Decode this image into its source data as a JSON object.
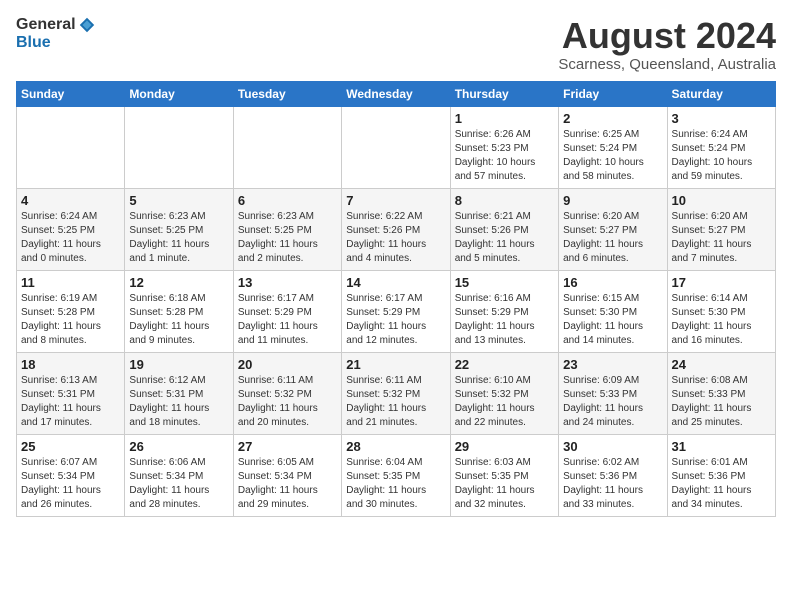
{
  "header": {
    "logo": {
      "general": "General",
      "blue": "Blue"
    },
    "month_year": "August 2024",
    "location": "Scarness, Queensland, Australia"
  },
  "weekdays": [
    "Sunday",
    "Monday",
    "Tuesday",
    "Wednesday",
    "Thursday",
    "Friday",
    "Saturday"
  ],
  "weeks": [
    [
      {
        "day": "",
        "info": ""
      },
      {
        "day": "",
        "info": ""
      },
      {
        "day": "",
        "info": ""
      },
      {
        "day": "",
        "info": ""
      },
      {
        "day": "1",
        "info": "Sunrise: 6:26 AM\nSunset: 5:23 PM\nDaylight: 10 hours\nand 57 minutes."
      },
      {
        "day": "2",
        "info": "Sunrise: 6:25 AM\nSunset: 5:24 PM\nDaylight: 10 hours\nand 58 minutes."
      },
      {
        "day": "3",
        "info": "Sunrise: 6:24 AM\nSunset: 5:24 PM\nDaylight: 10 hours\nand 59 minutes."
      }
    ],
    [
      {
        "day": "4",
        "info": "Sunrise: 6:24 AM\nSunset: 5:25 PM\nDaylight: 11 hours\nand 0 minutes."
      },
      {
        "day": "5",
        "info": "Sunrise: 6:23 AM\nSunset: 5:25 PM\nDaylight: 11 hours\nand 1 minute."
      },
      {
        "day": "6",
        "info": "Sunrise: 6:23 AM\nSunset: 5:25 PM\nDaylight: 11 hours\nand 2 minutes."
      },
      {
        "day": "7",
        "info": "Sunrise: 6:22 AM\nSunset: 5:26 PM\nDaylight: 11 hours\nand 4 minutes."
      },
      {
        "day": "8",
        "info": "Sunrise: 6:21 AM\nSunset: 5:26 PM\nDaylight: 11 hours\nand 5 minutes."
      },
      {
        "day": "9",
        "info": "Sunrise: 6:20 AM\nSunset: 5:27 PM\nDaylight: 11 hours\nand 6 minutes."
      },
      {
        "day": "10",
        "info": "Sunrise: 6:20 AM\nSunset: 5:27 PM\nDaylight: 11 hours\nand 7 minutes."
      }
    ],
    [
      {
        "day": "11",
        "info": "Sunrise: 6:19 AM\nSunset: 5:28 PM\nDaylight: 11 hours\nand 8 minutes."
      },
      {
        "day": "12",
        "info": "Sunrise: 6:18 AM\nSunset: 5:28 PM\nDaylight: 11 hours\nand 9 minutes."
      },
      {
        "day": "13",
        "info": "Sunrise: 6:17 AM\nSunset: 5:29 PM\nDaylight: 11 hours\nand 11 minutes."
      },
      {
        "day": "14",
        "info": "Sunrise: 6:17 AM\nSunset: 5:29 PM\nDaylight: 11 hours\nand 12 minutes."
      },
      {
        "day": "15",
        "info": "Sunrise: 6:16 AM\nSunset: 5:29 PM\nDaylight: 11 hours\nand 13 minutes."
      },
      {
        "day": "16",
        "info": "Sunrise: 6:15 AM\nSunset: 5:30 PM\nDaylight: 11 hours\nand 14 minutes."
      },
      {
        "day": "17",
        "info": "Sunrise: 6:14 AM\nSunset: 5:30 PM\nDaylight: 11 hours\nand 16 minutes."
      }
    ],
    [
      {
        "day": "18",
        "info": "Sunrise: 6:13 AM\nSunset: 5:31 PM\nDaylight: 11 hours\nand 17 minutes."
      },
      {
        "day": "19",
        "info": "Sunrise: 6:12 AM\nSunset: 5:31 PM\nDaylight: 11 hours\nand 18 minutes."
      },
      {
        "day": "20",
        "info": "Sunrise: 6:11 AM\nSunset: 5:32 PM\nDaylight: 11 hours\nand 20 minutes."
      },
      {
        "day": "21",
        "info": "Sunrise: 6:11 AM\nSunset: 5:32 PM\nDaylight: 11 hours\nand 21 minutes."
      },
      {
        "day": "22",
        "info": "Sunrise: 6:10 AM\nSunset: 5:32 PM\nDaylight: 11 hours\nand 22 minutes."
      },
      {
        "day": "23",
        "info": "Sunrise: 6:09 AM\nSunset: 5:33 PM\nDaylight: 11 hours\nand 24 minutes."
      },
      {
        "day": "24",
        "info": "Sunrise: 6:08 AM\nSunset: 5:33 PM\nDaylight: 11 hours\nand 25 minutes."
      }
    ],
    [
      {
        "day": "25",
        "info": "Sunrise: 6:07 AM\nSunset: 5:34 PM\nDaylight: 11 hours\nand 26 minutes."
      },
      {
        "day": "26",
        "info": "Sunrise: 6:06 AM\nSunset: 5:34 PM\nDaylight: 11 hours\nand 28 minutes."
      },
      {
        "day": "27",
        "info": "Sunrise: 6:05 AM\nSunset: 5:34 PM\nDaylight: 11 hours\nand 29 minutes."
      },
      {
        "day": "28",
        "info": "Sunrise: 6:04 AM\nSunset: 5:35 PM\nDaylight: 11 hours\nand 30 minutes."
      },
      {
        "day": "29",
        "info": "Sunrise: 6:03 AM\nSunset: 5:35 PM\nDaylight: 11 hours\nand 32 minutes."
      },
      {
        "day": "30",
        "info": "Sunrise: 6:02 AM\nSunset: 5:36 PM\nDaylight: 11 hours\nand 33 minutes."
      },
      {
        "day": "31",
        "info": "Sunrise: 6:01 AM\nSunset: 5:36 PM\nDaylight: 11 hours\nand 34 minutes."
      }
    ]
  ]
}
